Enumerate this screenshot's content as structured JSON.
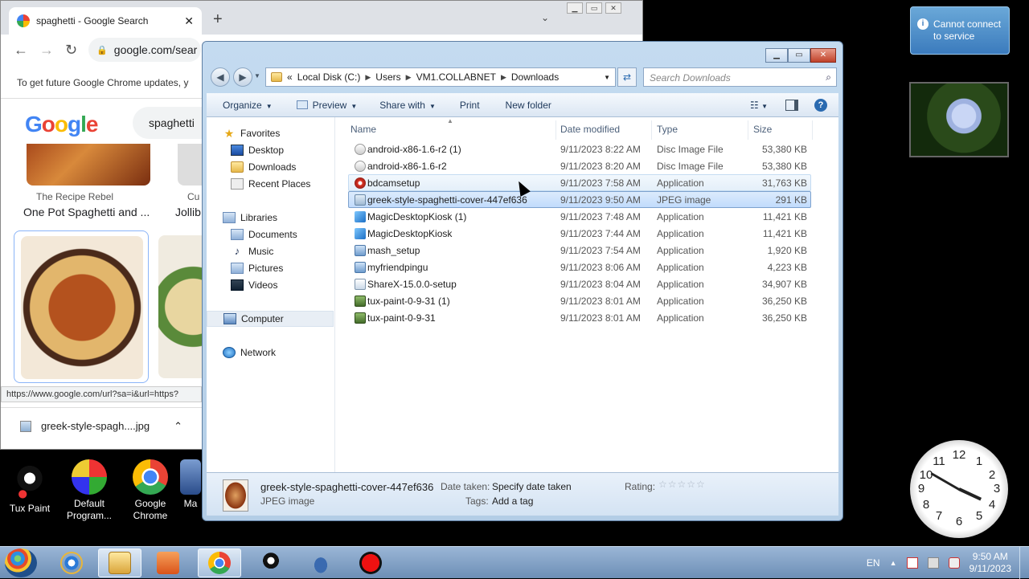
{
  "chrome": {
    "tab_title": "spaghetti - Google Search",
    "new_tab_symbol": "+",
    "url": "google.com/sear",
    "infobar": "To get future Google Chrome updates, y",
    "logo": "Google",
    "search_query": "spaghetti",
    "results": [
      {
        "source": "The Recipe Rebel",
        "title": "One Pot Spaghetti and ..."
      },
      {
        "source": "Cu",
        "title": "Jollib"
      }
    ],
    "status_url": "https://www.google.com/url?sa=i&url=https?",
    "download_file": "greek-style-spagh....jpg"
  },
  "desktop": {
    "icons": [
      {
        "label": "Tux Paint"
      },
      {
        "label": "Default Program..."
      },
      {
        "label": "Google Chrome"
      },
      {
        "label": "Ma"
      }
    ],
    "gadget_message": "Cannot connect to service",
    "clock_numbers": [
      "12",
      "1",
      "2",
      "3",
      "4",
      "5",
      "6",
      "7",
      "8",
      "9",
      "10",
      "11"
    ]
  },
  "explorer": {
    "breadcrumb": [
      "Local Disk (C:)",
      "Users",
      "VM1.COLLABNET",
      "Downloads"
    ],
    "breadcrumb_prefix": "«",
    "search_placeholder": "Search Downloads",
    "toolbar": {
      "organize": "Organize",
      "preview": "Preview",
      "share_with": "Share with",
      "print": "Print",
      "new_folder": "New folder"
    },
    "nav": {
      "favorites": "Favorites",
      "desktop": "Desktop",
      "downloads": "Downloads",
      "recent": "Recent Places",
      "libraries": "Libraries",
      "documents": "Documents",
      "music": "Music",
      "pictures": "Pictures",
      "videos": "Videos",
      "computer": "Computer",
      "network": "Network"
    },
    "columns": {
      "name": "Name",
      "date": "Date modified",
      "type": "Type",
      "size": "Size"
    },
    "files": [
      {
        "name": "android-x86-1.6-r2 (1)",
        "date": "9/11/2023 8:22 AM",
        "type": "Disc Image File",
        "size": "53,380 KB",
        "icon": "iso"
      },
      {
        "name": "android-x86-1.6-r2",
        "date": "9/11/2023 8:20 AM",
        "type": "Disc Image File",
        "size": "53,380 KB",
        "icon": "iso"
      },
      {
        "name": "bdcamsetup",
        "date": "9/11/2023 7:58 AM",
        "type": "Application",
        "size": "31,763 KB",
        "icon": "bdc"
      },
      {
        "name": "greek-style-spaghetti-cover-447ef636",
        "date": "9/11/2023 9:50 AM",
        "type": "JPEG image",
        "size": "291 KB",
        "icon": "jpg"
      },
      {
        "name": "MagicDesktopKiosk (1)",
        "date": "9/11/2023 7:48 AM",
        "type": "Application",
        "size": "11,421 KB",
        "icon": "mdk"
      },
      {
        "name": "MagicDesktopKiosk",
        "date": "9/11/2023 7:44 AM",
        "type": "Application",
        "size": "11,421 KB",
        "icon": "mdk"
      },
      {
        "name": "mash_setup",
        "date": "9/11/2023 7:54 AM",
        "type": "Application",
        "size": "1,920 KB",
        "icon": "app"
      },
      {
        "name": "myfriendpingu",
        "date": "9/11/2023 8:06 AM",
        "type": "Application",
        "size": "4,223 KB",
        "icon": "app"
      },
      {
        "name": "ShareX-15.0.0-setup",
        "date": "9/11/2023 8:04 AM",
        "type": "Application",
        "size": "34,907 KB",
        "icon": "sharex"
      },
      {
        "name": "tux-paint-0-9-31 (1)",
        "date": "9/11/2023 8:01 AM",
        "type": "Application",
        "size": "36,250 KB",
        "icon": "tux"
      },
      {
        "name": "tux-paint-0-9-31",
        "date": "9/11/2023 8:01 AM",
        "type": "Application",
        "size": "36,250 KB",
        "icon": "tux"
      }
    ],
    "details": {
      "filename": "greek-style-spaghetti-cover-447ef636",
      "filetype": "JPEG image",
      "date_label": "Date taken:",
      "date_value": "Specify date taken",
      "tags_label": "Tags:",
      "tags_value": "Add a tag",
      "rating_label": "Rating:",
      "rating_stars": "☆☆☆☆☆"
    }
  },
  "taskbar": {
    "lang": "EN",
    "time": "9:50 AM",
    "date": "9/11/2023"
  }
}
